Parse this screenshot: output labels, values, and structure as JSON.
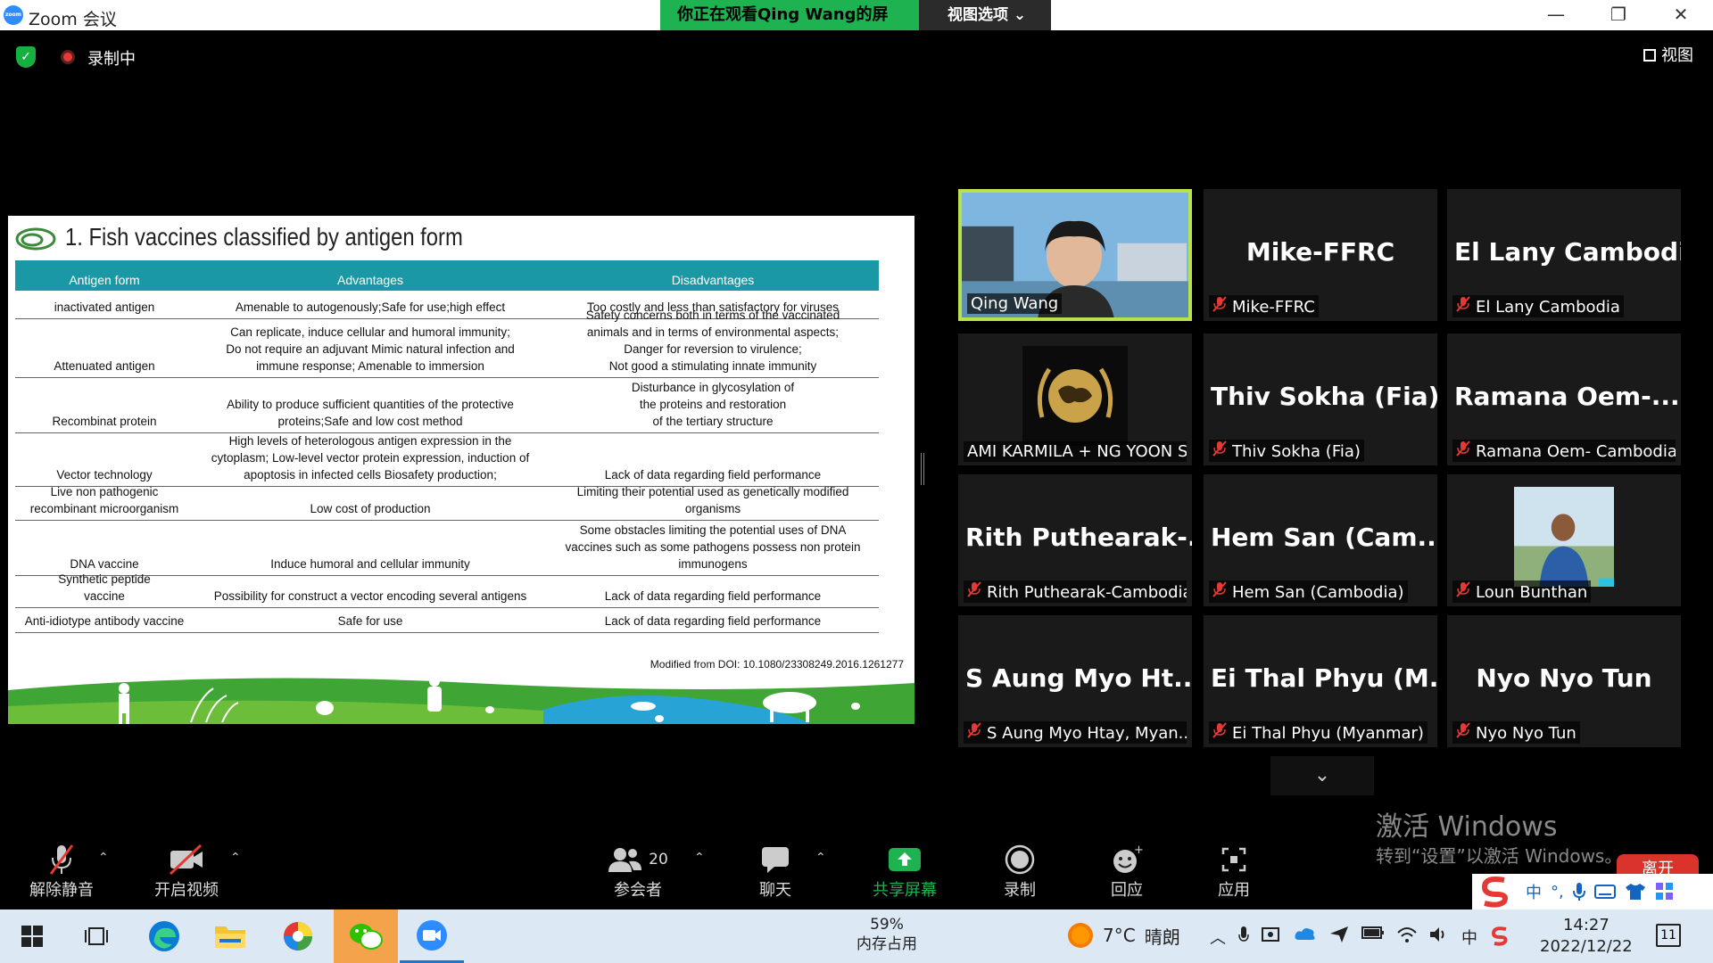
{
  "titlebar": {
    "logo_text": "zoom",
    "app_title": "Zoom 会议",
    "viewing_banner": "你正在观看Qing Wang的屏幕",
    "view_options": "视图选项 ⌄",
    "minimize": "—",
    "restore": "❐",
    "close": "✕"
  },
  "meeting_bar": {
    "shield_icon": "✓",
    "recording_label": "录制中",
    "view_label": "视图"
  },
  "slide": {
    "title": "1. Fish vaccines classified by antigen form",
    "headers": [
      "Antigen form",
      "Advantages",
      "Disadvantages"
    ],
    "rows": [
      {
        "form": "inactivated antigen",
        "adv": "Amenable to autogenously;Safe for use;high effect",
        "dis": "Too costly and less than satisfactory for viruses"
      },
      {
        "form": "Attenuated antigen",
        "adv": "Can replicate, induce cellular and humoral immunity;\nDo not require an adjuvant Mimic natural infection and\nimmune response; Amenable to immersion",
        "dis": "Safety concerns both in terms of the vaccinated\nanimals and in terms of environmental aspects;\nDanger for reversion to virulence;\nNot good a stimulating innate immunity"
      },
      {
        "form": "Recombinat protein",
        "adv": "Ability to produce sufficient quantities of the protective\nproteins;Safe and low cost method",
        "dis": "Disturbance in glycosylation of\nthe proteins and restoration\nof the tertiary structure"
      },
      {
        "form": "Vector technology",
        "adv": "High levels of heterologous antigen expression in the\ncytoplasm; Low-level vector protein expression, induction of\napoptosis in infected cells Biosafety production;",
        "dis": "Lack of data regarding field performance"
      },
      {
        "form": "Live non pathogenic\nrecombinant microorganism",
        "adv": "Low cost of production",
        "dis": "Limiting their potential used as genetically modified\norganisms"
      },
      {
        "form": "DNA vaccine",
        "adv": "Induce humoral and cellular immunity",
        "dis": "Some obstacles limiting the potential uses of DNA\nvaccines such as some pathogens possess non protein\nimmunogens"
      },
      {
        "form": "Synthetic peptide\nvaccine",
        "adv": "Possibility for construct a vector encoding several antigens",
        "dis": "Lack of data regarding field performance"
      },
      {
        "form": "Anti-idiotype antibody vaccine",
        "adv": "Safe for use",
        "dis": "Lack of data regarding field performance"
      }
    ],
    "source": "Modified from DOI: 10.1080/23308249.2016.1261277",
    "header_color": "#1a98a6"
  },
  "tiles": [
    {
      "big_name": "",
      "label": "Qing Wang",
      "muted": false,
      "active": true,
      "kind": "video"
    },
    {
      "big_name": "Mike-FFRC",
      "label": "Mike-FFRC",
      "muted": true,
      "active": false,
      "kind": "name"
    },
    {
      "big_name": "El Lany Cambodia",
      "label": "El Lany Cambodia",
      "muted": true,
      "active": false,
      "kind": "name"
    },
    {
      "big_name": "",
      "label": "AMI KARMILA + NG YOON S...",
      "muted": false,
      "active": false,
      "kind": "logo"
    },
    {
      "big_name": "Thiv Sokha (Fia)",
      "label": "Thiv Sokha (Fia)",
      "muted": true,
      "active": false,
      "kind": "name"
    },
    {
      "big_name": "Ramana  Oem-...",
      "label": "Ramana Oem- Cambodia",
      "muted": true,
      "active": false,
      "kind": "name"
    },
    {
      "big_name": "Rith  Puthearak-...",
      "label": "Rith Puthearak-Cambodia",
      "muted": true,
      "active": false,
      "kind": "name"
    },
    {
      "big_name": "Hem  San  (Cam...",
      "label": "Hem San (Cambodia)",
      "muted": true,
      "active": false,
      "kind": "name"
    },
    {
      "big_name": "",
      "label": "Loun Bunthan",
      "muted": true,
      "active": false,
      "kind": "photo"
    },
    {
      "big_name": "S  Aung  Myo  Ht...",
      "label": "S Aung Myo Htay, Myan...",
      "muted": true,
      "active": false,
      "kind": "name"
    },
    {
      "big_name": "Ei  Thal  Phyu  (M...",
      "label": "Ei Thal Phyu (Myanmar)",
      "muted": true,
      "active": false,
      "kind": "name"
    },
    {
      "big_name": "Nyo Nyo Tun",
      "label": "Nyo Nyo Tun",
      "muted": true,
      "active": false,
      "kind": "name"
    }
  ],
  "more_arrow": "⌄",
  "activate": {
    "line1": "激活 Windows",
    "line2": "转到“设置”以激活 Windows。"
  },
  "toolbar": {
    "unmute": "解除静音",
    "start_video": "开启视频",
    "participants_count": "20",
    "participants": "参会者",
    "chat": "聊天",
    "share_screen": "共享屏幕",
    "record": "录制",
    "reactions": "回应",
    "apps": "应用",
    "leave": "离开",
    "share_color": "#1fb250"
  },
  "ime": {
    "lang": "中",
    "punct": "°,"
  },
  "taskbar": {
    "mem_percent": "59%",
    "mem_label": "内存占用",
    "temperature": "7°C",
    "weather": "晴朗",
    "ime_lang": "中",
    "time": "14:27",
    "date": "2022/12/22",
    "notification_count": "11"
  }
}
